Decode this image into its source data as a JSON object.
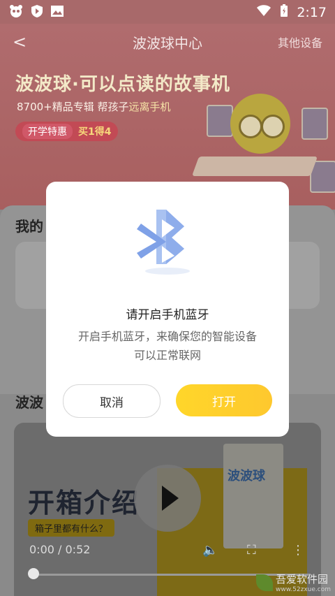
{
  "status_bar": {
    "time": "2:17",
    "left_icons": [
      "panda-app-icon",
      "shield-play-icon",
      "image-icon"
    ],
    "right_icons": [
      "wifi-icon",
      "battery-charging-icon"
    ]
  },
  "navbar": {
    "back_glyph": "<",
    "title": "波波球中心",
    "right_link": "其他设备"
  },
  "banner": {
    "title": "波波球·可以点读的故事机",
    "subtitle_prefix": "8700+精品专辑 帮孩子",
    "subtitle_highlight": "远离手机",
    "promo_tag": "开学特惠",
    "promo_text": "买1得4"
  },
  "section1": {
    "label": "我的"
  },
  "section2": {
    "label": "波波"
  },
  "video": {
    "headline": "开箱介绍",
    "question": "箱子里都有什么？",
    "time": "0:00 / 0:52",
    "product_label": "波波球",
    "progress": 0
  },
  "dialog": {
    "title": "请开启手机蓝牙",
    "message_line1": "开启手机蓝牙，来确保您的智能设备",
    "message_line2": "可以正常联网",
    "cancel_label": "取消",
    "confirm_label": "打开"
  },
  "watermark": {
    "text": "吾爱软件园",
    "url": "www.52zxue.com"
  },
  "colors": {
    "accent": "#ffd22a",
    "dialog_bg": "#ffffff",
    "overlay_status": "#a8696a",
    "bluetooth": "#8fb2ee"
  }
}
